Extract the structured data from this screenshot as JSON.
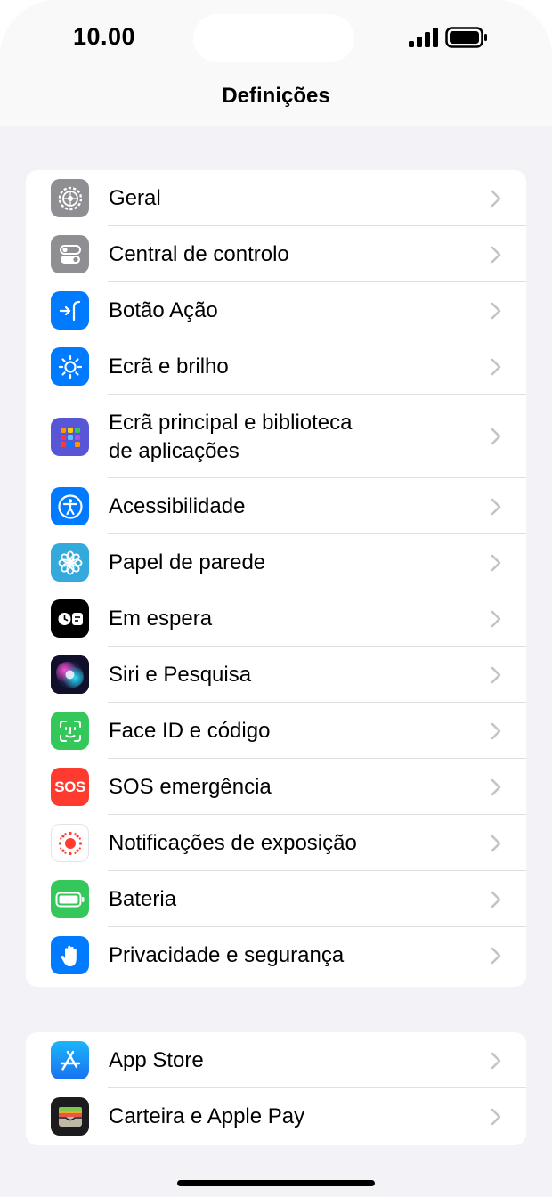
{
  "status_bar": {
    "time": "10.00"
  },
  "nav": {
    "title": "Definições"
  },
  "group1": {
    "items": [
      {
        "label": "Geral",
        "icon": "gear-icon",
        "color": "#8e8e93"
      },
      {
        "label": "Central de controlo",
        "icon": "toggles-icon",
        "color": "#8e8e93"
      },
      {
        "label": "Botão Ação",
        "icon": "action-button-icon",
        "color": "#007aff"
      },
      {
        "label": "Ecrã e brilho",
        "icon": "sun-icon",
        "color": "#007aff"
      },
      {
        "label": "Ecrã principal e biblioteca",
        "label2": "de aplicações",
        "icon": "app-grid-icon",
        "color": "#5856d6"
      },
      {
        "label": "Acessibilidade",
        "icon": "accessibility-icon",
        "color": "#007aff"
      },
      {
        "label": "Papel de parede",
        "icon": "flower-icon",
        "color": "#34aadc"
      },
      {
        "label": "Em espera",
        "icon": "standby-icon",
        "color": "#000000"
      },
      {
        "label": "Siri e Pesquisa",
        "icon": "siri-icon",
        "color": "#1c1c3a"
      },
      {
        "label": "Face ID e código",
        "icon": "face-id-icon",
        "color": "#34c759"
      },
      {
        "label": "SOS emergência",
        "icon": "sos-icon",
        "color": "#ff3b30",
        "icon_text": "SOS"
      },
      {
        "label": "Notificações de exposição",
        "icon": "exposure-icon",
        "color": "#ffffff"
      },
      {
        "label": "Bateria",
        "icon": "battery-icon",
        "color": "#34c759"
      },
      {
        "label": "Privacidade e segurança",
        "icon": "hand-icon",
        "color": "#007aff"
      }
    ]
  },
  "group2": {
    "items": [
      {
        "label": "App Store",
        "icon": "app-store-icon",
        "color": "#1e90ff"
      },
      {
        "label": "Carteira e Apple Pay",
        "icon": "wallet-icon",
        "color": "#1c1c1e"
      }
    ]
  }
}
